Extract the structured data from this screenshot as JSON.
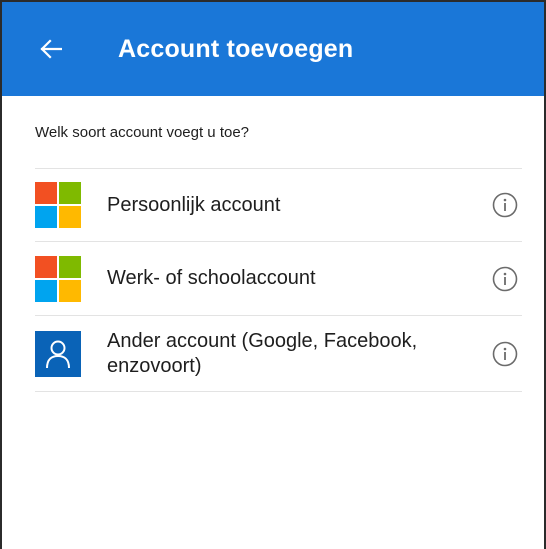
{
  "appbar": {
    "title": "Account toevoegen",
    "back_icon": "arrow-left-icon",
    "color": "#1a77d8"
  },
  "prompt": "Welk soort account voegt u toe?",
  "accounts": [
    {
      "label": "Persoonlijk account",
      "logo": "microsoft-logo",
      "info_icon": "info-icon"
    },
    {
      "label": "Werk- of schoolaccount",
      "logo": "microsoft-logo",
      "info_icon": "info-icon"
    },
    {
      "label": "Ander account (Google, Facebook, enzovoort)",
      "logo": "person-icon",
      "info_icon": "info-icon"
    }
  ]
}
